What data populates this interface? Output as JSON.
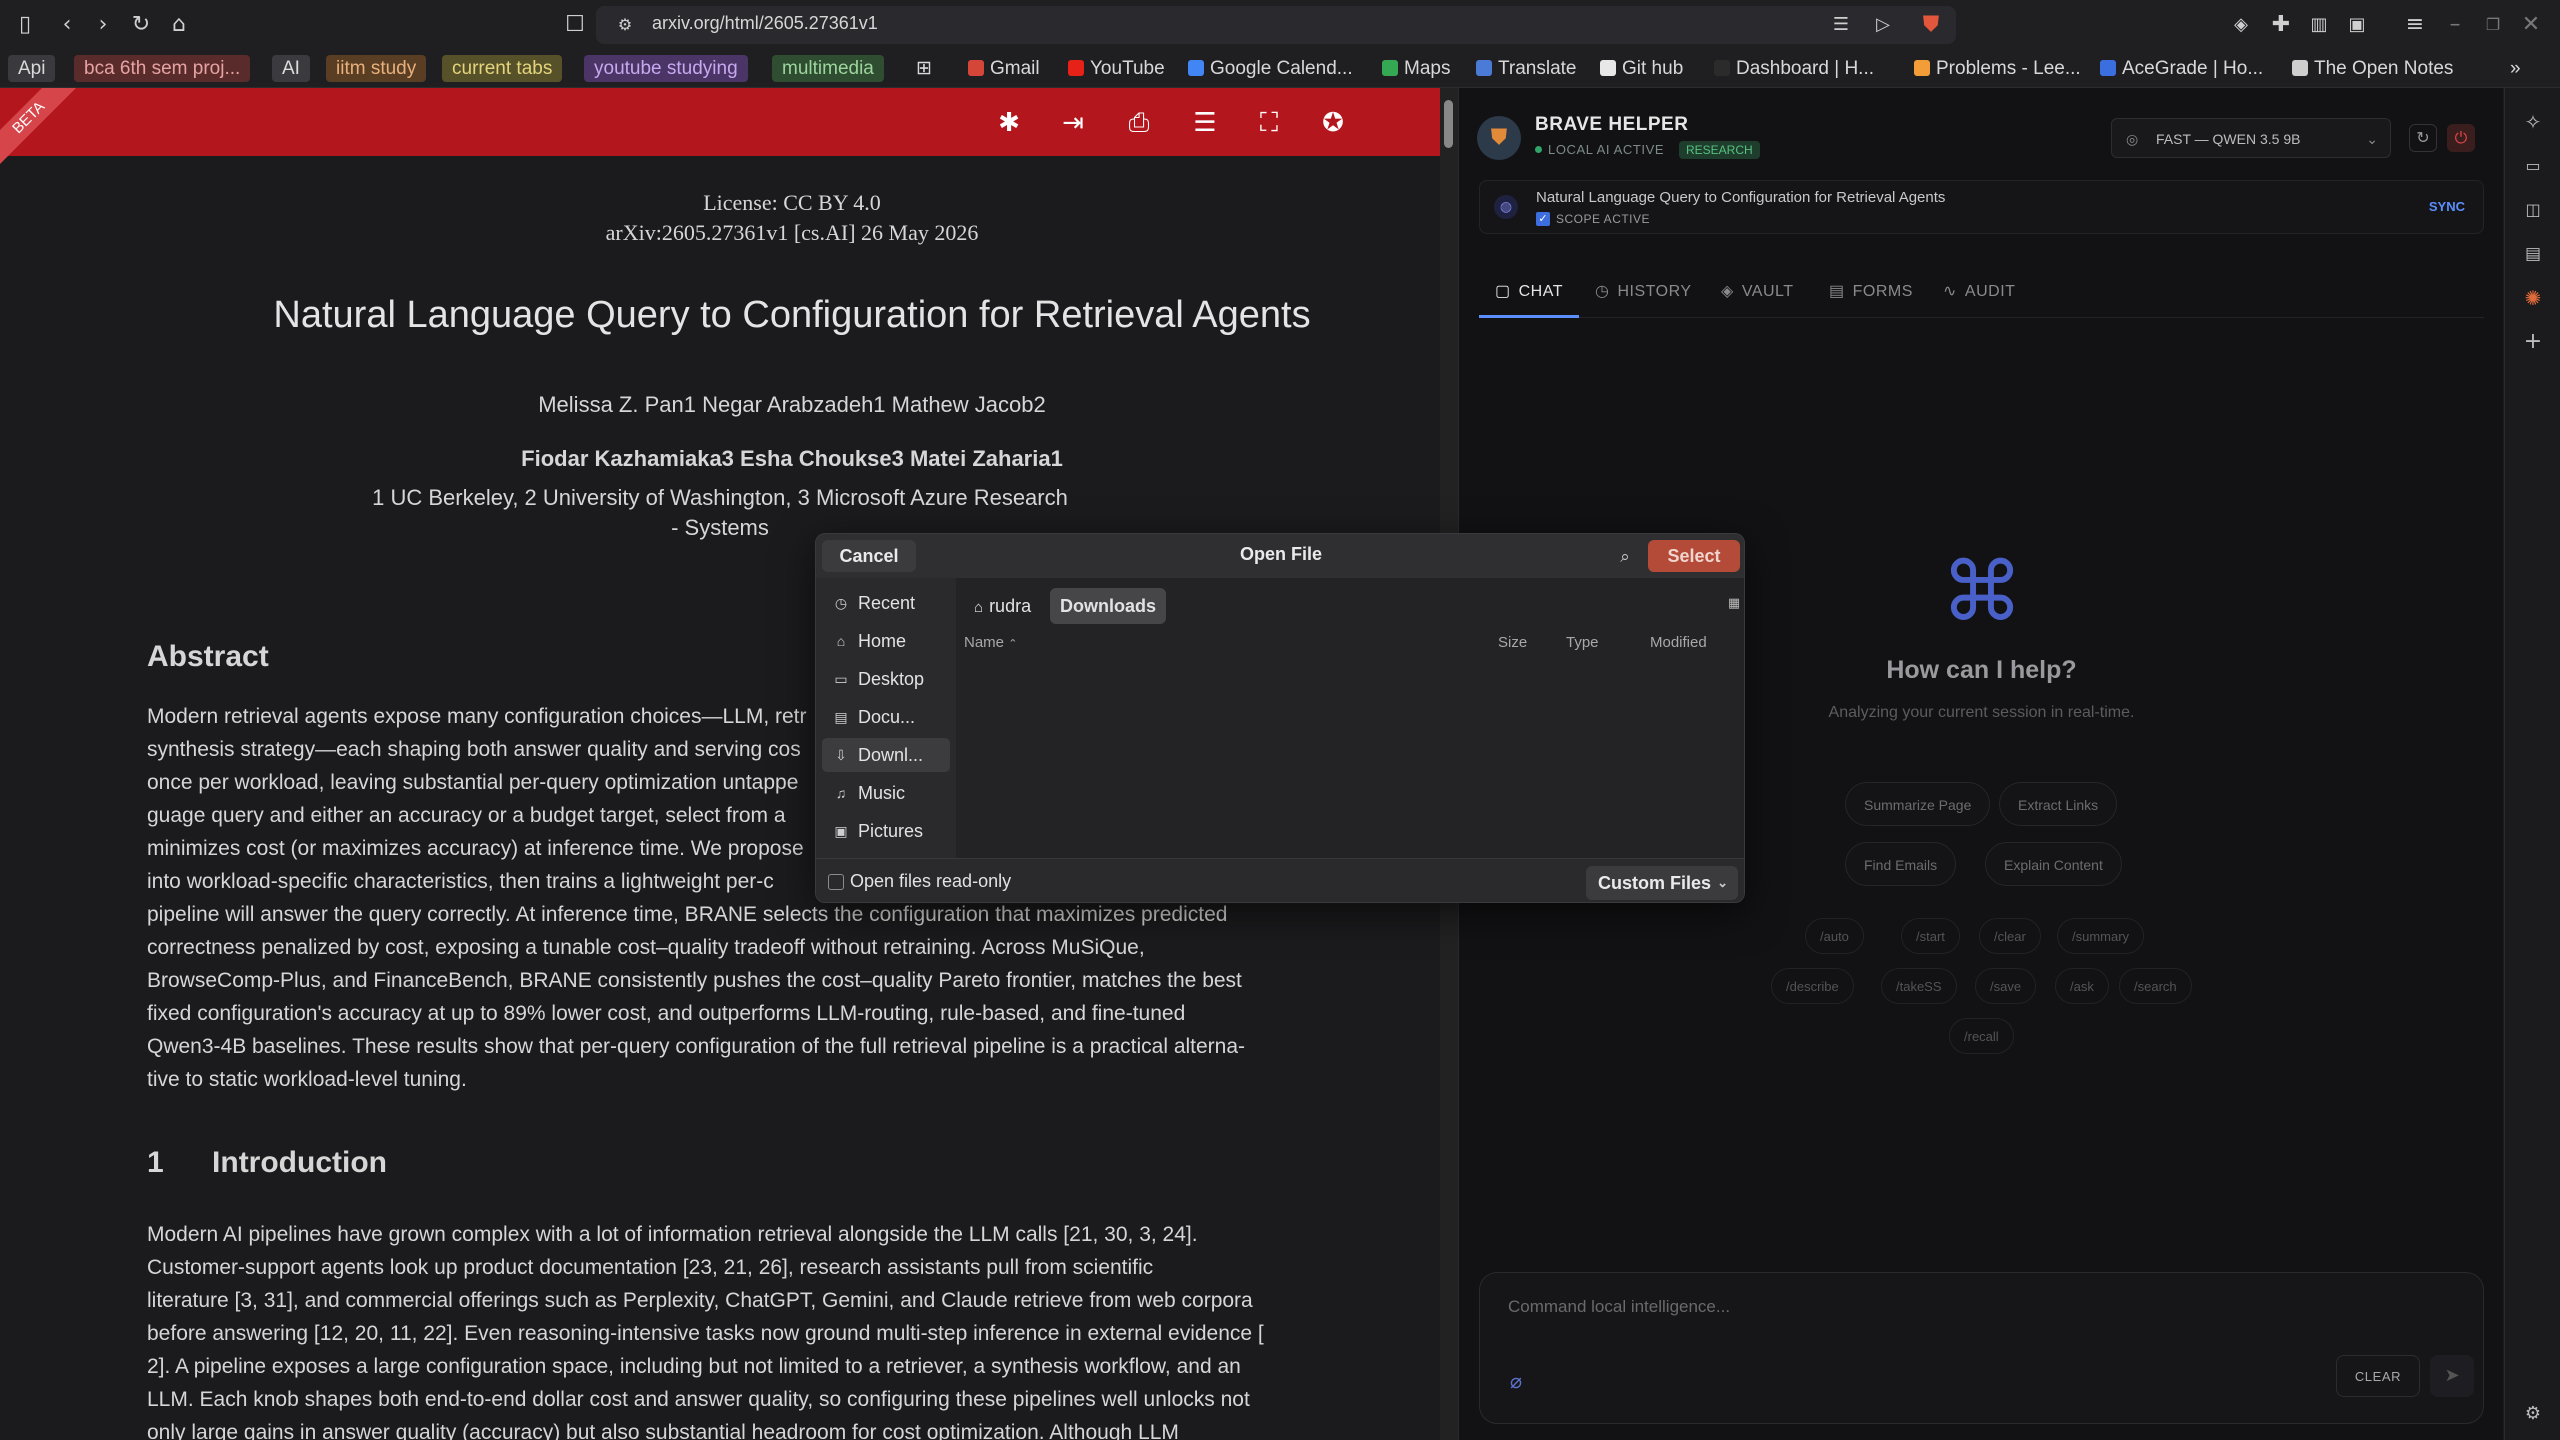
{
  "browser": {
    "url": "arxiv.org/html/2605.27361v1",
    "bookmarks": [
      {
        "label": "Api",
        "style": "bm-tag"
      },
      {
        "label": "bca 6th sem proj...",
        "style": "bm-red"
      },
      {
        "label": "AI",
        "style": "bm-grey"
      },
      {
        "label": "iitm study",
        "style": "bm-orange"
      },
      {
        "label": "current tabs",
        "style": "bm-yellow"
      },
      {
        "label": "youtube studying",
        "style": "bm-purple"
      },
      {
        "label": "multimedia",
        "style": "bm-green"
      },
      {
        "label": "Gmail",
        "fav": "#d44638"
      },
      {
        "label": "YouTube",
        "fav": "#e62117"
      },
      {
        "label": "Google Calend...",
        "fav": "#4285f4"
      },
      {
        "label": "Maps",
        "fav": "#34a853"
      },
      {
        "label": "Translate",
        "fav": "#4a7bd6"
      },
      {
        "label": "Git hub",
        "fav": "#e8e8e8"
      },
      {
        "label": "Dashboard | H...",
        "fav": "#2b2b2b"
      },
      {
        "label": "Problems - Lee...",
        "fav": "#f29d38"
      },
      {
        "label": "AceGrade | Ho...",
        "fav": "#3b6fe0"
      },
      {
        "label": "The Open Notes",
        "fav": "#cfcfcf"
      }
    ]
  },
  "paper": {
    "beta": "BETA",
    "license": "License: CC BY 4.0",
    "arxiv": "arXiv:2605.27361v1 [cs.AI] 26 May 2026",
    "title": "Natural Language Query to Configuration for Retrieval Agents",
    "authors_line1": "Melissa Z. Pan1   Negar Arabzadeh1   Mathew Jacob2",
    "authors_line2": "Fiodar Kazhamiaka3   Esha Choukse3   Matei Zaharia1",
    "affiliations": "1 UC Berkeley, 2 University of Washington, 3 Microsoft Azure Research - Systems",
    "abstract_heading": "Abstract",
    "abstract_lines": [
      "Modern retrieval agents expose many configuration choices—LLM, retr",
      "synthesis strategy—each shaping both answer quality and serving cos",
      "once per workload, leaving substantial per-query optimization untappe",
      "guage query and either an accuracy or a budget target, select from a",
      "minimizes cost (or maximizes accuracy) at inference time. We propose",
      "into workload-specific characteristics, then trains a lightweight per-c",
      "pipeline will answer the query correctly. At inference time, BRANE selects the configuration that maximizes predicted",
      "correctness penalized by cost, exposing a tunable cost–quality tradeoff without retraining. Across MuSiQue,",
      "BrowseComp-Plus, and FinanceBench, BRANE consistently pushes the cost–quality Pareto frontier, matches the best",
      "fixed configuration's accuracy at up to 89% lower cost, and outperforms LLM-routing, rule-based, and fine-tuned",
      "Qwen3-4B baselines. These results show that per-query configuration of the full retrieval pipeline is a practical alterna-",
      "tive to static workload-level tuning."
    ],
    "intro_number": "1",
    "intro_heading": "Introduction",
    "intro_lines": [
      "Modern AI pipelines have grown complex with a lot of information retrieval alongside the LLM calls [21, 30, 3, 24].",
      "Customer-support agents look up product documentation [23, 21, 26], research assistants pull from scientific",
      "literature [3, 31], and commercial offerings such as Perplexity, ChatGPT, Gemini, and Claude retrieve from web corpora",
      "before answering [12, 20, 11, 22]. Even reasoning-intensive tasks now ground multi-step inference in external evidence [",
      "2]. A pipeline exposes a large configuration space, including but not limited to a retriever, a synthesis workflow, and an",
      "LLM. Each knob shapes both end-to-end dollar cost and answer quality, so configuring these pipelines well unlocks not",
      "only large gains in answer quality (accuracy) but also substantial headroom for cost optimization. Although LLM"
    ]
  },
  "helper": {
    "title": "BRAVE HELPER",
    "status": "LOCAL AI ACTIVE",
    "badge": "RESEARCH",
    "model": "FAST — QWEN 3.5 9B",
    "scope_title": "Natural Language Query to Configuration for Retrieval Agents",
    "scope_label": "SCOPE ACTIVE",
    "sync": "SYNC",
    "tabs": [
      "CHAT",
      "HISTORY",
      "VAULT",
      "FORMS",
      "AUDIT"
    ],
    "help_title": "How can I help?",
    "help_sub": "Analyzing your current session in real-time.",
    "actions": [
      "Summarize Page",
      "Extract Links",
      "Find Emails",
      "Explain Content"
    ],
    "commands": [
      "/auto",
      "/start",
      "/clear",
      "/summary",
      "/describe",
      "/takeSS",
      "/save",
      "/ask",
      "/search",
      "/recall"
    ],
    "input_placeholder": "Command local intelligence...",
    "clear": "CLEAR"
  },
  "dialog": {
    "cancel": "Cancel",
    "title": "Open File",
    "select": "Select",
    "places": [
      "Recent",
      "Home",
      "Desktop",
      "Docu...",
      "Downl...",
      "Music",
      "Pictures"
    ],
    "crumbs": [
      "rudra",
      "Downloads"
    ],
    "columns": {
      "name": "Name",
      "size": "Size",
      "type": "Type",
      "modified": "Modified"
    },
    "readonly": "Open files read-only",
    "filter": "Custom Files"
  }
}
